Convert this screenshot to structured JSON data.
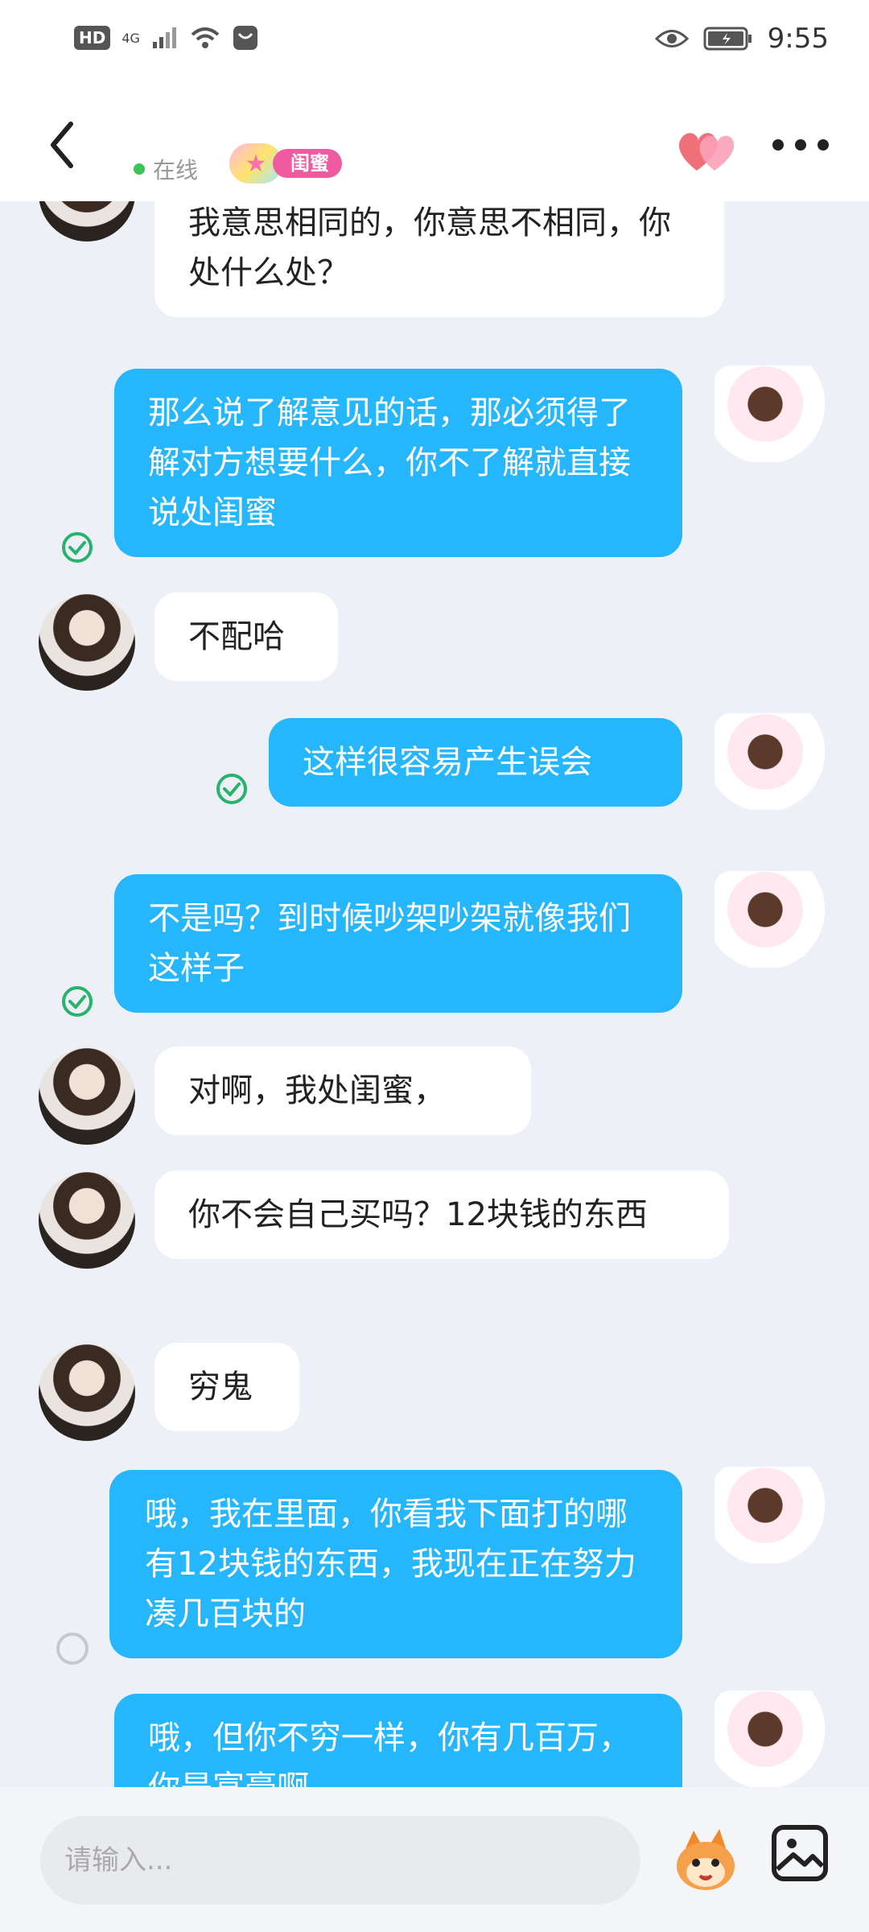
{
  "status_bar": {
    "network_badge": "HD",
    "network_type": "4G",
    "time": "9:55"
  },
  "header": {
    "online_label": "在线",
    "tag_label": "闺蜜"
  },
  "messages": [
    {
      "side": "in",
      "text": "对啊，但是我提出我闺蜜应该是和我意思相同的，你意思不相同，你处什么处？"
    },
    {
      "side": "out",
      "text": "那么说了解意见的话，那必须得了解对方想要什么，你不了解就直接说处闺蜜",
      "status": "read"
    },
    {
      "side": "in",
      "text": "不配哈"
    },
    {
      "side": "out",
      "text": "这样很容易产生误会",
      "status": "read"
    },
    {
      "side": "out",
      "text": "不是吗？到时候吵架吵架就像我们这样子",
      "status": "read"
    },
    {
      "side": "in",
      "text": "对啊，我处闺蜜，"
    },
    {
      "side": "in",
      "text": "你不会自己买吗？12块钱的东西"
    },
    {
      "side": "in",
      "text": "穷鬼"
    },
    {
      "side": "out",
      "text": "哦，我在里面，你看我下面打的哪有12块钱的东西，我现在正在努力凑几百块的",
      "status": "pending"
    },
    {
      "side": "out",
      "text": "哦，但你不穷一样，你有几百万，你是富豪啊"
    }
  ],
  "input": {
    "placeholder": "请输入..."
  },
  "colors": {
    "outgoing_bubble": "#25b6fb",
    "incoming_bubble": "#ffffff",
    "read_check": "#27b36b",
    "online_dot": "#3ec25a",
    "tag": "#f05aa0"
  }
}
